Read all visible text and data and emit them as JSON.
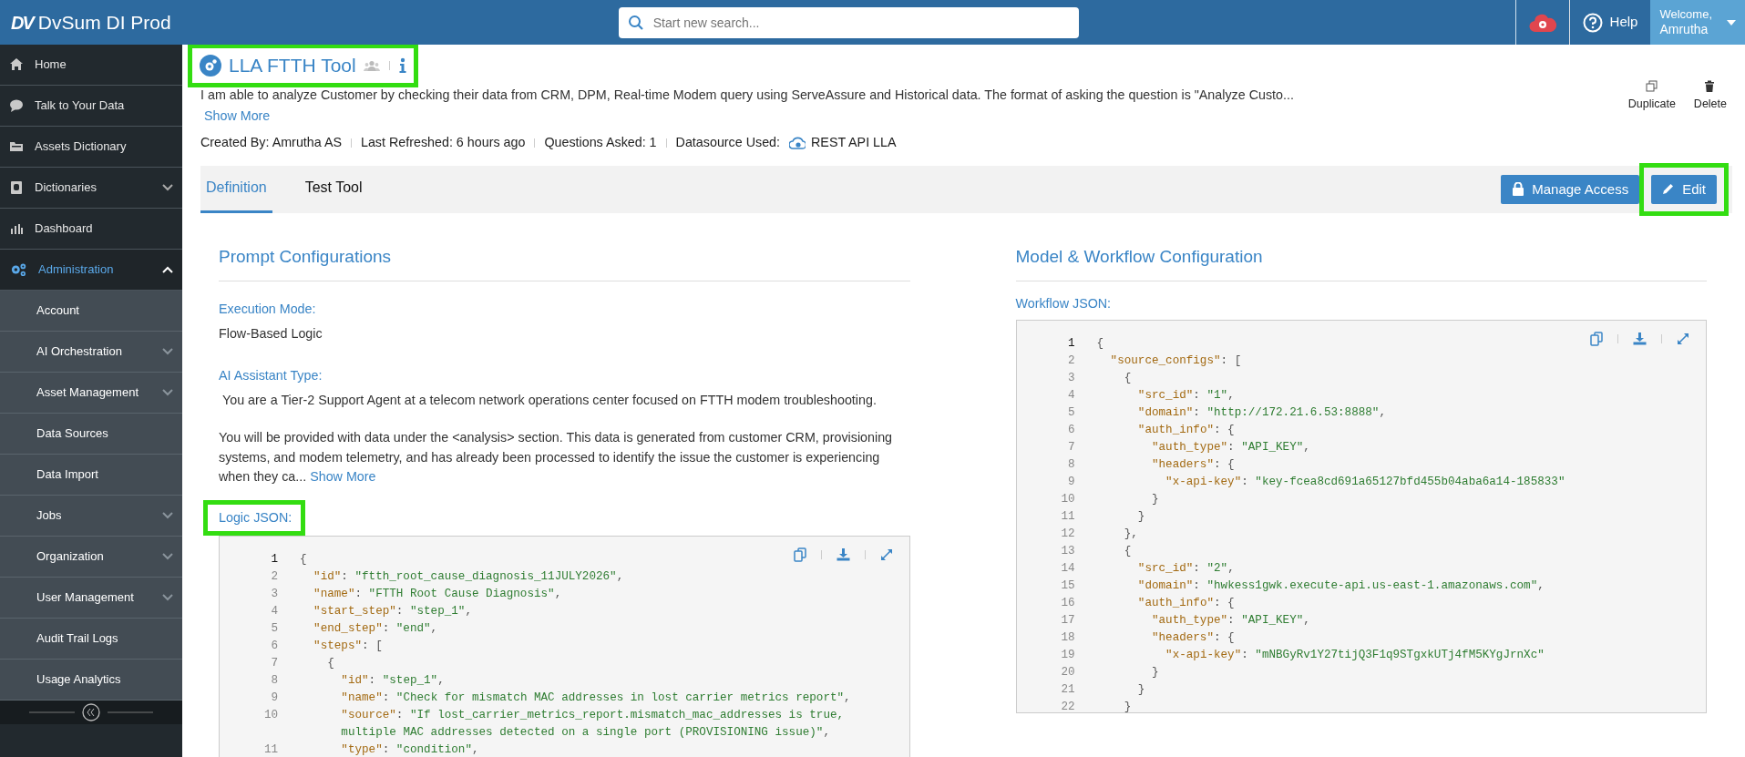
{
  "topbar": {
    "logo_mark": "DV",
    "app_name": "DvSum DI Prod",
    "search": {
      "placeholder": "Start new search..."
    },
    "help": "Help",
    "welcome": "Welcome,",
    "user": "Amrutha"
  },
  "sidebar": {
    "items": [
      {
        "label": "Home",
        "kind": "link",
        "active": false
      },
      {
        "label": "Talk to Your Data",
        "kind": "link",
        "active": false
      },
      {
        "label": "Assets Dictionary",
        "kind": "link",
        "active": false
      },
      {
        "label": "Dictionaries",
        "kind": "group",
        "active": false,
        "expanded": false
      },
      {
        "label": "Dashboard",
        "kind": "link",
        "active": false
      },
      {
        "label": "Administration",
        "kind": "group",
        "active": true,
        "expanded": true,
        "children": [
          {
            "label": "Account",
            "kind": "link"
          },
          {
            "label": "AI Orchestration",
            "kind": "group",
            "expanded": false
          },
          {
            "label": "Asset Management",
            "kind": "group",
            "expanded": false
          },
          {
            "label": "Data Sources",
            "kind": "link"
          },
          {
            "label": "Data Import",
            "kind": "link"
          },
          {
            "label": "Jobs",
            "kind": "group",
            "expanded": false
          },
          {
            "label": "Organization",
            "kind": "group",
            "expanded": false
          },
          {
            "label": "User Management",
            "kind": "group",
            "expanded": false
          },
          {
            "label": "Audit Trail Logs",
            "kind": "link"
          },
          {
            "label": "Usage Analytics",
            "kind": "link"
          }
        ]
      }
    ]
  },
  "tool": {
    "title": "LLA FTTH Tool",
    "highlighted": true,
    "description": "I am able to analyze Customer by checking their data from CRM, DPM, Real-time Modem query using ServeAssure and Historical data. The format of asking the question is \"Analyze Custo...",
    "show_more": "Show More",
    "actions": [
      {
        "label": "Duplicate",
        "kind": "duplicate"
      },
      {
        "label": "Delete",
        "kind": "delete"
      }
    ],
    "meta": [
      {
        "label": "Created By:",
        "value": "Amrutha AS",
        "kind": "text"
      },
      {
        "label": "Last Refreshed:",
        "value": "6 hours ago",
        "kind": "text"
      },
      {
        "label": "Questions Asked:",
        "value": "1",
        "kind": "text"
      },
      {
        "label": "Datasource Used:",
        "value": "REST API LLA",
        "kind": "datasource"
      }
    ]
  },
  "tabs": [
    {
      "label": "Definition",
      "selected": true
    },
    {
      "label": "Test Tool",
      "selected": false
    }
  ],
  "toolbar_buttons": [
    {
      "label": "Manage Access",
      "kind": "lock",
      "highlighted": false
    },
    {
      "label": "Edit",
      "kind": "edit",
      "highlighted": true
    }
  ],
  "prompt": {
    "heading": "Prompt Configurations",
    "execution_mode": {
      "label": "Execution Mode:",
      "value": "Flow-Based Logic"
    },
    "assistant_type": {
      "label": "AI Assistant Type:",
      "paragraphs": [
        " You are a Tier-2 Support Agent at a telecom network operations center focused on FTTH modem troubleshooting.",
        "You will be provided with data under the <analysis> section. This data is generated from customer CRM, provisioning systems, and modem telemetry, and has already been processed to identify the issue the customer is experiencing when they ca..."
      ],
      "show_more": "Show More"
    },
    "logic": {
      "label": "Logic JSON:",
      "highlighted": true,
      "lines": [
        {
          "n": "1",
          "text": "{",
          "active": true
        },
        {
          "n": "2",
          "text": "  \"id\": \"ftth_root_cause_diagnosis_11JULY2026\",",
          "active": false
        },
        {
          "n": "3",
          "text": "  \"name\": \"FTTH Root Cause Diagnosis\",",
          "active": false
        },
        {
          "n": "4",
          "text": "  \"start_step\": \"step_1\",",
          "active": false
        },
        {
          "n": "5",
          "text": "  \"end_step\": \"end\",",
          "active": false
        },
        {
          "n": "6",
          "text": "  \"steps\": [",
          "active": false
        },
        {
          "n": "7",
          "text": "    {",
          "active": false
        },
        {
          "n": "8",
          "text": "      \"id\": \"step_1\",",
          "active": false
        },
        {
          "n": "9",
          "text": "      \"name\": \"Check for mismatch MAC addresses in lost carrier metrics report\",",
          "active": false
        },
        {
          "n": "10",
          "text": "      \"source\": \"If lost_carrier_metrics_report.mismatch_mac_addresses is true, multiple MAC addresses detected on a single port (PROVISIONING issue)\",",
          "active": false
        },
        {
          "n": "11",
          "text": "      \"type\": \"condition\",",
          "active": false
        }
      ]
    }
  },
  "model": {
    "heading": "Model & Workflow Configuration",
    "workflow": {
      "label": "Workflow JSON:",
      "lines": [
        {
          "n": "1",
          "text": "{",
          "active": true
        },
        {
          "n": "2",
          "text": "  \"source_configs\": [",
          "active": false
        },
        {
          "n": "3",
          "text": "    {",
          "active": false
        },
        {
          "n": "4",
          "text": "      \"src_id\": \"1\",",
          "active": false
        },
        {
          "n": "5",
          "text": "      \"domain\": \"http://172.21.6.53:8888\",",
          "active": false
        },
        {
          "n": "6",
          "text": "      \"auth_info\": {",
          "active": false
        },
        {
          "n": "7",
          "text": "        \"auth_type\": \"API_KEY\",",
          "active": false
        },
        {
          "n": "8",
          "text": "        \"headers\": {",
          "active": false
        },
        {
          "n": "9",
          "text": "          \"x-api-key\": \"key-fcea8cd691a65127bfd455b04aba6a14-185833\"",
          "active": false
        },
        {
          "n": "10",
          "text": "        }",
          "active": false
        },
        {
          "n": "11",
          "text": "      }",
          "active": false
        },
        {
          "n": "12",
          "text": "    },",
          "active": false
        },
        {
          "n": "13",
          "text": "    {",
          "active": false
        },
        {
          "n": "14",
          "text": "      \"src_id\": \"2\",",
          "active": false
        },
        {
          "n": "15",
          "text": "      \"domain\": \"hwkess1gwk.execute-api.us-east-1.amazonaws.com\",",
          "active": false
        },
        {
          "n": "16",
          "text": "      \"auth_info\": {",
          "active": false
        },
        {
          "n": "17",
          "text": "        \"auth_type\": \"API_KEY\",",
          "active": false
        },
        {
          "n": "18",
          "text": "        \"headers\": {",
          "active": false
        },
        {
          "n": "19",
          "text": "          \"x-api-key\": \"mNBGyRv1Y27tijQ3F1q9STgxkUTj4fM5KYgJrnXc\"",
          "active": false
        },
        {
          "n": "20",
          "text": "        }",
          "active": false
        },
        {
          "n": "21",
          "text": "      }",
          "active": false
        },
        {
          "n": "22",
          "text": "    }",
          "active": false
        }
      ]
    }
  }
}
